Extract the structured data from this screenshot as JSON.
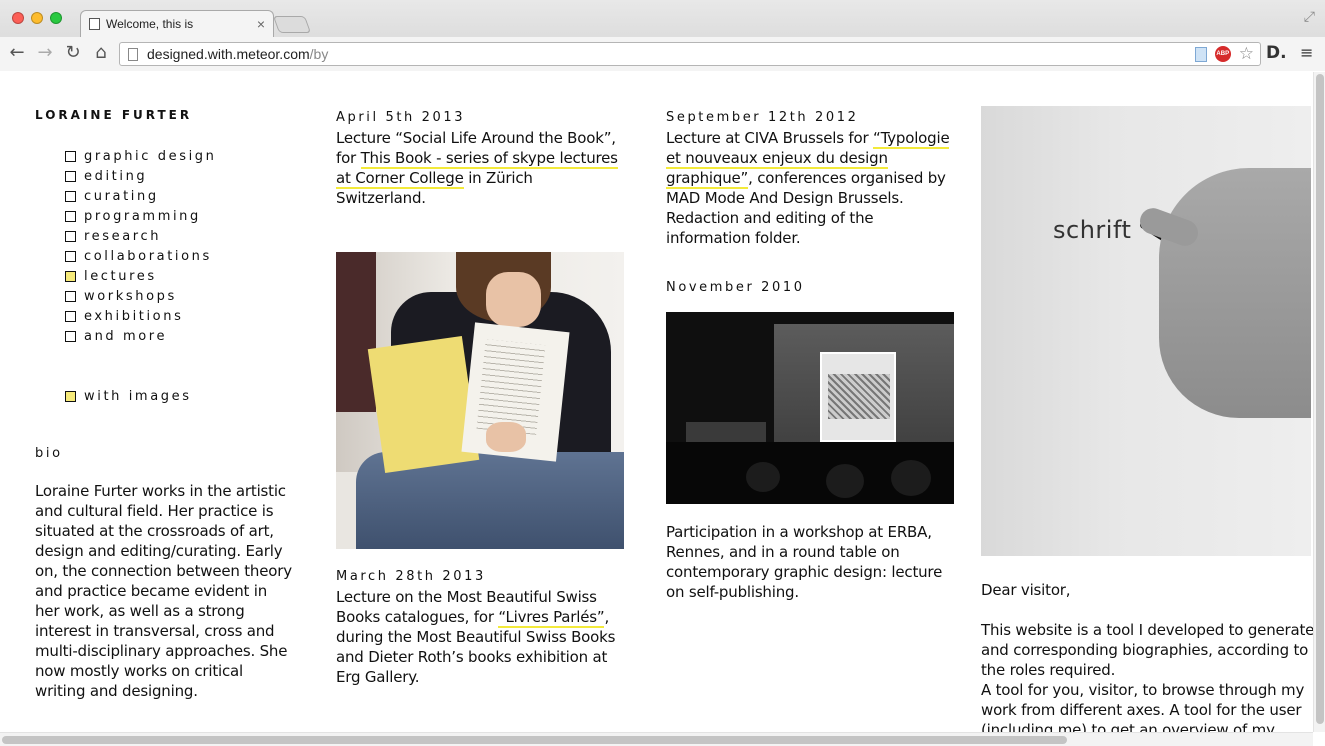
{
  "browser": {
    "tab_title": "Welcome, this is",
    "url_host": "designed.with.meteor.com",
    "url_path": "/by",
    "extension_label": "D.",
    "abp_label": "ABP"
  },
  "sidebar": {
    "name": "LORAINE FURTER",
    "filters": [
      {
        "label": "graphic design",
        "checked": false
      },
      {
        "label": "editing",
        "checked": false
      },
      {
        "label": "curating",
        "checked": false
      },
      {
        "label": "programming",
        "checked": false
      },
      {
        "label": "research",
        "checked": false
      },
      {
        "label": "collaborations",
        "checked": false
      },
      {
        "label": "lectures",
        "checked": true
      },
      {
        "label": "workshops",
        "checked": false
      },
      {
        "label": "exhibitions",
        "checked": false
      },
      {
        "label": "and more",
        "checked": false
      }
    ],
    "with_images": {
      "label": "with images",
      "checked": true
    },
    "bio_label": "bio",
    "bio_text": "Loraine Furter works in the artistic and cultural field. Her practice is situated at the crossroads of art, design and editing/curating. Early on, the connection between theory and practice became evident in her work, as well as a strong interest in transversal, cross and multi-disciplinary approaches. She now mostly works on critical writing and designing."
  },
  "entries": {
    "e1": {
      "date": "April 5th 2013",
      "t1": "Lecture “Social Life Around the Book”, for ",
      "link": "This Book - series of skype lectures at Corner College",
      "t2": " in Zürich Switzerland."
    },
    "e2": {
      "date": "March 28th 2013",
      "t1": "Lecture on the Most Beautiful Swiss Books catalogues, for ",
      "link": "“Livres Parlés”",
      "t2": ", during the Most Beautiful Swiss Books and Dieter Roth’s books exhibition at Erg Gallery."
    },
    "e3": {
      "date": "September 12th 2012",
      "t1": "Lecture at CIVA Brussels for ",
      "link": "“Typologie et nouveaux enjeux du design graphique”",
      "t2": ", conferences organised by MAD Mode And Design Brussels. Redaction and editing of the information folder."
    },
    "e4": {
      "date": "November 2010",
      "text": "Participation in a workshop at ERBA, Rennes, and in a round table on contemporary graphic design: lecture on self-publishing."
    }
  },
  "photo_word": "schrift",
  "intro": {
    "greeting": "Dear visitor,",
    "p1": "This website is a tool I developed to generate and corresponding biographies, according to the roles required.",
    "p2": "A tool for you, visitor, to browse through my work from different axes. A tool for the user (including me) to get an overview of my work, and generate a printable"
  },
  "colors": {
    "accent_underline": "#f3ea3a",
    "checked_fill": "#f6ea7a"
  }
}
